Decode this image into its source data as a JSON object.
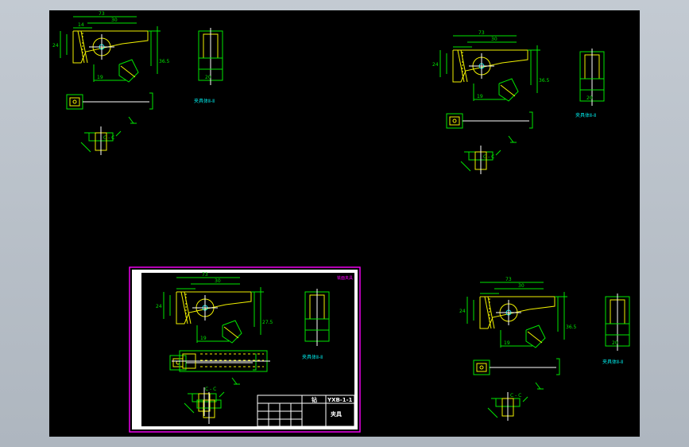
{
  "drawing": {
    "dims": {
      "d73": "73",
      "d30": "30",
      "d14": "14",
      "d24": "24",
      "d19": "19",
      "d20": "20",
      "d9": "9",
      "d36": "36.5",
      "d27": "27.5"
    },
    "section_label": "C - C",
    "view_labels": {
      "top_left": "夹具体Ⅱ-Ⅱ",
      "top_right": "夹具体Ⅱ-Ⅱ",
      "frame": "夹具体Ⅱ-Ⅱ",
      "bottom_right": "夹具体Ⅱ-Ⅱ"
    },
    "frame_tag": "铣面夹具",
    "title_block": {
      "code": "YXB-1-1",
      "name": "夹具",
      "short": "钻"
    }
  }
}
